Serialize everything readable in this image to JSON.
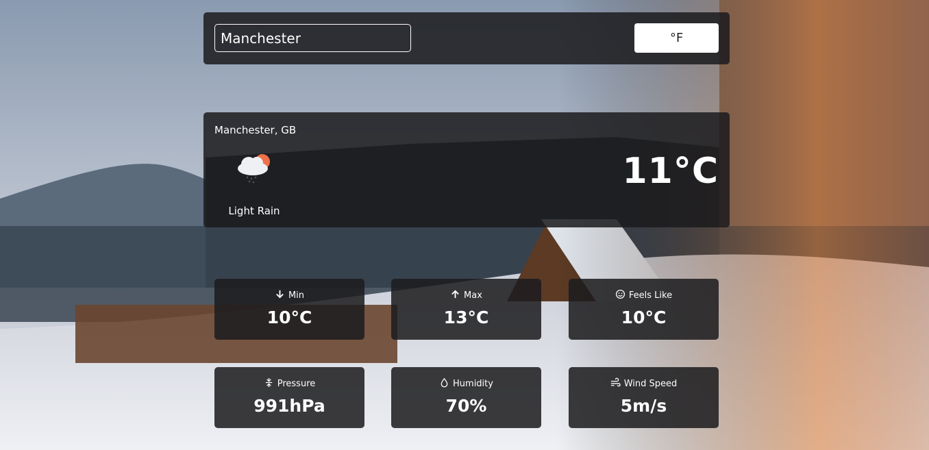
{
  "search": {
    "value": "Manchester"
  },
  "unit_toggle": {
    "label": "°F"
  },
  "current": {
    "location": "Manchester, GB",
    "condition": "Light Rain",
    "condition_icon": "cloud-rain-sun-icon",
    "temperature": "11°C"
  },
  "stats": {
    "min": {
      "label": "Min",
      "value": "10°C",
      "icon": "arrow-down-icon"
    },
    "max": {
      "label": "Max",
      "value": "13°C",
      "icon": "arrow-up-icon"
    },
    "feels_like": {
      "label": "Feels Like",
      "value": "10°C",
      "icon": "smile-icon"
    },
    "pressure": {
      "label": "Pressure",
      "value": "991hPa",
      "icon": "compress-icon"
    },
    "humidity": {
      "label": "Humidity",
      "value": "70%",
      "icon": "droplet-icon"
    },
    "wind_speed": {
      "label": "Wind Speed",
      "value": "5m/s",
      "icon": "wind-icon"
    }
  },
  "colors": {
    "panel": "#1c1c1e",
    "button_bg": "#ffffff",
    "text": "#ffffff"
  }
}
